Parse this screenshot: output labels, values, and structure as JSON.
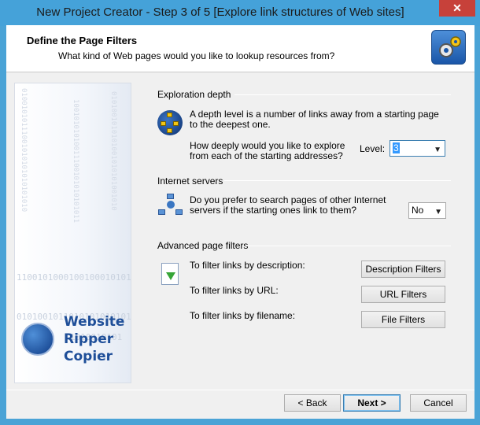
{
  "window": {
    "title": "New Project Creator - Step 3 of 5 [Explore link structures of Web sites]",
    "close_glyph": "✕"
  },
  "header": {
    "title": "Define the Page Filters",
    "subtitle": "What kind of Web pages would you like to lookup resources from?",
    "icon": "gears-icon"
  },
  "left_panel": {
    "binary_rows": [
      "1100101000100100010101",
      "0101001011010101010101",
      "1010010101"
    ],
    "binary_columns": [
      "01001010111001010101010101010",
      "10010101010011100101010101011",
      "0101001010101001010101001010"
    ],
    "logo_lines": [
      "Website",
      "Ripper",
      "Copier"
    ],
    "logo_icon": "globe-icon"
  },
  "exploration": {
    "heading": "Exploration depth",
    "description": "A depth level is a number of links away from a starting page to the deepest one.",
    "question": "How deeply would you like to explore from each of the starting addresses?",
    "level_label": "Level:",
    "level_value": "3",
    "icon": "link-tree-icon"
  },
  "internet_servers": {
    "heading": "Internet servers",
    "question": "Do you prefer to search pages of other Internet servers if the starting ones link to them?",
    "value": "No",
    "icon": "network-servers-icon"
  },
  "advanced": {
    "heading": "Advanced page filters",
    "icon": "filter-icon",
    "rows": [
      {
        "label": "To filter links by description:",
        "button": "Description Filters"
      },
      {
        "label": "To filter links by URL:",
        "button": "URL Filters"
      },
      {
        "label": "To filter links by filename:",
        "button": "File Filters"
      }
    ]
  },
  "footer": {
    "back": "< Back",
    "next": "Next >",
    "cancel": "Cancel"
  }
}
